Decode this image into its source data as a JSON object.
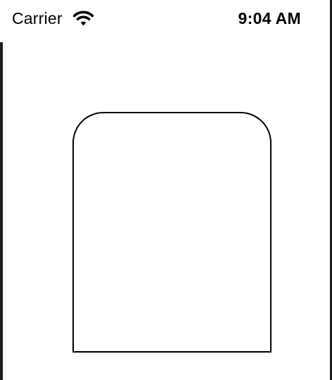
{
  "status_bar": {
    "carrier": "Carrier",
    "time": "9:04 AM",
    "wifi_icon": "wifi-icon"
  },
  "content": {
    "card_icon": "rounded-rectangle-shape"
  }
}
